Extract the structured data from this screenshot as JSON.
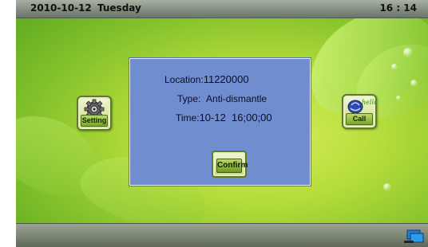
{
  "status_bar": {
    "date": "2010-10-12",
    "weekday": "Tuesday",
    "time": "16 : 14"
  },
  "side_buttons": {
    "setting_label": "Setting",
    "call_label": "Call",
    "call_icon_text": "hello"
  },
  "alarm_dialog": {
    "location_label": "Location:",
    "location_value": "11220000",
    "type_label": "Type:",
    "type_value": "Anti-dismantle",
    "time_label": "Time:",
    "time_value": "10-12  16;00;00",
    "confirm_label": "Confirm"
  },
  "icons": {
    "setting": "gear-icon",
    "call": "phone-icon",
    "corner": "monitor-icon"
  },
  "colors": {
    "dialog_bg": "#6f8dcf",
    "bar": "#808a7f",
    "background": "#b4dc3a"
  }
}
